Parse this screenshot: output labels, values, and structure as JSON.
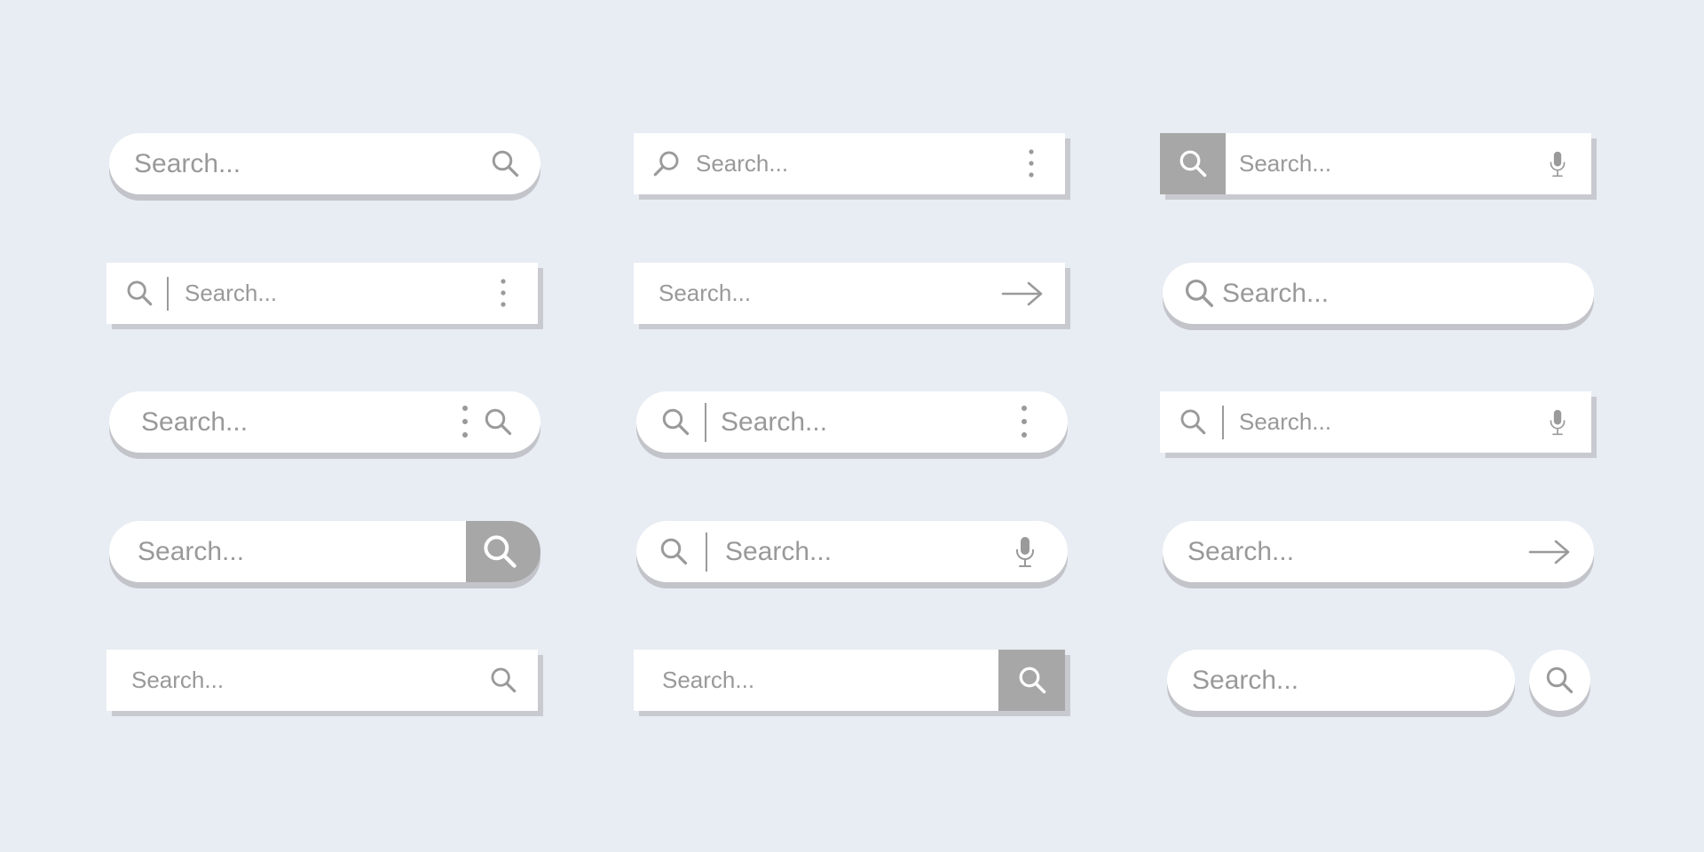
{
  "search_bars": [
    {
      "placeholder": "Search..."
    },
    {
      "placeholder": "Search..."
    },
    {
      "placeholder": "Search..."
    },
    {
      "placeholder": "Search..."
    },
    {
      "placeholder": "Search..."
    },
    {
      "placeholder": "Search..."
    },
    {
      "placeholder": "Search..."
    },
    {
      "placeholder": "Search..."
    },
    {
      "placeholder": "Search..."
    },
    {
      "placeholder": "Search..."
    },
    {
      "placeholder": "Search..."
    },
    {
      "placeholder": "Search..."
    },
    {
      "placeholder": "Search..."
    },
    {
      "placeholder": "Search..."
    },
    {
      "placeholder": "Search..."
    }
  ],
  "colors": {
    "background": "#e8ecf3",
    "bar": "#ffffff",
    "shadow": "#c8cacf",
    "placeholder_text": "#999999",
    "icon": "#9a9a9a",
    "button_fill": "#a7a7a7",
    "button_icon": "#ffffff"
  },
  "icons": [
    "search-icon",
    "more-vertical-icon",
    "microphone-icon",
    "arrow-right-icon"
  ]
}
